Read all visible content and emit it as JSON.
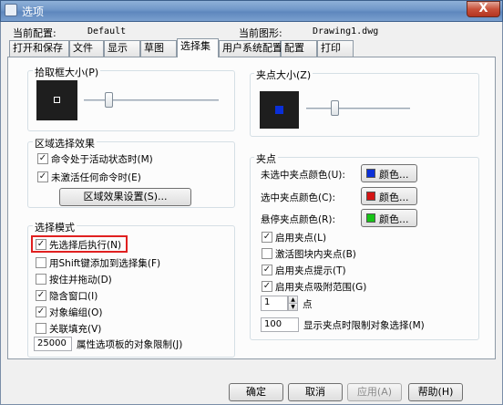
{
  "window": {
    "title": "选项",
    "close_glyph": "X"
  },
  "header": {
    "current_config_label": "当前配置:",
    "current_config_value": "Default",
    "current_drawing_label": "当前图形:",
    "current_drawing_value": "Drawing1.dwg"
  },
  "tabs": [
    {
      "label": "打开和保存"
    },
    {
      "label": "文件"
    },
    {
      "label": "显示"
    },
    {
      "label": "草图"
    },
    {
      "label": "选择集",
      "active": true
    },
    {
      "label": "用户系统配置"
    },
    {
      "label": "配置"
    },
    {
      "label": "打印"
    }
  ],
  "pickbox": {
    "label": "拾取框大小(P)",
    "slider_level": 0.18
  },
  "area_effects": {
    "label": "区域选择效果",
    "options": [
      {
        "label": "命令处于活动状态时(M)",
        "checked": true
      },
      {
        "label": "未激活任何命令时(E)",
        "checked": true
      }
    ],
    "settings_button": "区域效果设置(S)..."
  },
  "selection_modes": {
    "label": "选择模式",
    "options": [
      {
        "label": "先选择后执行(N)",
        "checked": true
      },
      {
        "label": "用Shift键添加到选择集(F)",
        "checked": false
      },
      {
        "label": "按住并拖动(D)",
        "checked": false
      },
      {
        "label": "隐含窗口(I)",
        "checked": true
      },
      {
        "label": "对象编组(O)",
        "checked": true
      },
      {
        "label": "关联填充(V)",
        "checked": false
      }
    ],
    "limit_value": "25000",
    "limit_label": "属性选项板的对象限制(J)"
  },
  "grip_size": {
    "label": "夹点大小(Z)",
    "slider_level": 0.3
  },
  "grips": {
    "label": "夹点",
    "colors": [
      {
        "label": "未选中夹点颜色(U):",
        "button": "颜色...",
        "color": "#0a2fd8"
      },
      {
        "label": "选中夹点颜色(C):",
        "button": "颜色...",
        "color": "#d41414"
      },
      {
        "label": "悬停夹点颜色(R):",
        "button": "颜色...",
        "color": "#18c418"
      }
    ],
    "options": [
      {
        "label": "启用夹点(L)",
        "checked": true
      },
      {
        "label": "激活图块内夹点(B)",
        "checked": false
      },
      {
        "label": "启用夹点提示(T)",
        "checked": true
      },
      {
        "label": "启用夹点吸附范围(G)",
        "checked": true
      }
    ],
    "snap_value": "1",
    "snap_unit": "点",
    "limit_value": "100",
    "limit_label": "显示夹点时限制对象选择(M)"
  },
  "footer": {
    "ok": "确定",
    "cancel": "取消",
    "apply": "应用(A)",
    "help": "帮助(H)"
  },
  "colors": {
    "preview_bg": "#1e1e1e",
    "grip_preview": "#0a2fd8",
    "highlight": "#e02020"
  }
}
